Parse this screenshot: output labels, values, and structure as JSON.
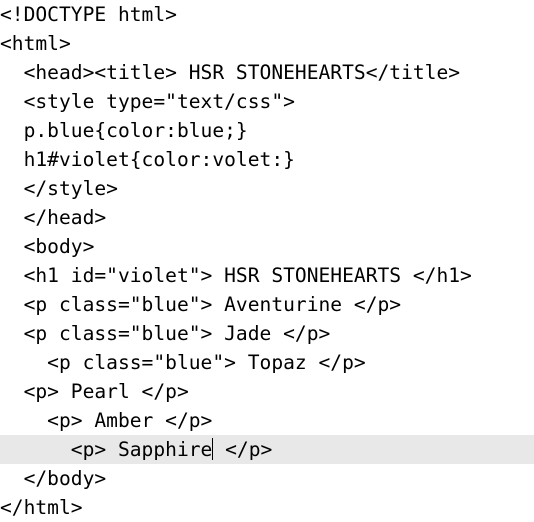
{
  "editor": {
    "current_line_index": 15,
    "lines": [
      "<!DOCTYPE html>",
      "<html>",
      "  <head><title> HSR STONEHEARTS</title>",
      "  <style type=\"text/css\">",
      "  p.blue{color:blue;}",
      "  h1#violet{color:volet:}",
      "  </style>",
      "  </head>",
      "  <body>",
      "  <h1 id=\"violet\"> HSR STONEHEARTS </h1>",
      "  <p class=\"blue\"> Aventurine </p>",
      "  <p class=\"blue\"> Jade </p>",
      "    <p class=\"blue\"> Topaz </p>",
      "  <p> Pearl </p>",
      "    <p> Amber </p>",
      "      <p> Sapphire",
      "  </body>",
      "</html>"
    ],
    "caret_line_suffix": " </p>"
  }
}
